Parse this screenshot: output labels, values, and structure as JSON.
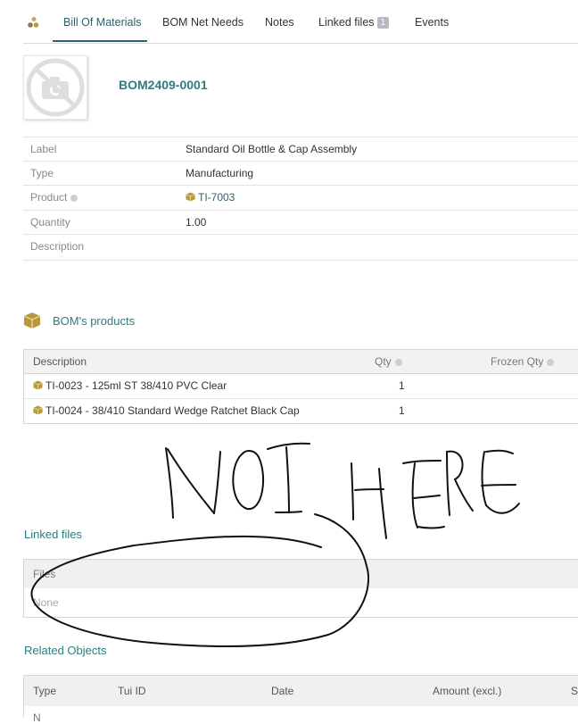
{
  "tabs": [
    {
      "label": "Bill Of Materials",
      "active": true
    },
    {
      "label": "BOM Net Needs"
    },
    {
      "label": "Notes"
    },
    {
      "label": "Linked files",
      "badge": "1"
    },
    {
      "label": "Events"
    }
  ],
  "header": {
    "ref": "BOM2409-0001"
  },
  "fields": [
    {
      "label": "Label",
      "value": "Standard Oil Bottle & Cap Assembly"
    },
    {
      "label": "Type",
      "value": "Manufacturing"
    },
    {
      "label": "Product",
      "value": "TI-7003",
      "has_info": true,
      "link": true
    },
    {
      "label": "Quantity",
      "value": "1.00"
    },
    {
      "label": "Description",
      "value": ""
    }
  ],
  "bom_products": {
    "title": "BOM's products",
    "columns": {
      "description": "Description",
      "qty": "Qty",
      "frozen_qty": "Frozen Qty"
    },
    "rows": [
      {
        "description": "TI-0023 - 125ml ST 38/410 PVC Clear",
        "qty": "1"
      },
      {
        "description": "TI-0024 - 38/410 Standard Wedge Ratchet Black Cap",
        "qty": "1"
      }
    ]
  },
  "annotation": {
    "text": "NOT HERE"
  },
  "linked_files": {
    "title": "Linked files",
    "column": "Files",
    "empty": "None"
  },
  "related_objects": {
    "title": "Related Objects",
    "columns": [
      "Type",
      "Tui ID",
      "Date",
      "Amount (excl.)",
      "S"
    ],
    "first_row_partial": "N"
  },
  "colors": {
    "accent": "#2d7d80",
    "tab_active": "#2f5f6b",
    "product_icon": "#b89a3a"
  }
}
